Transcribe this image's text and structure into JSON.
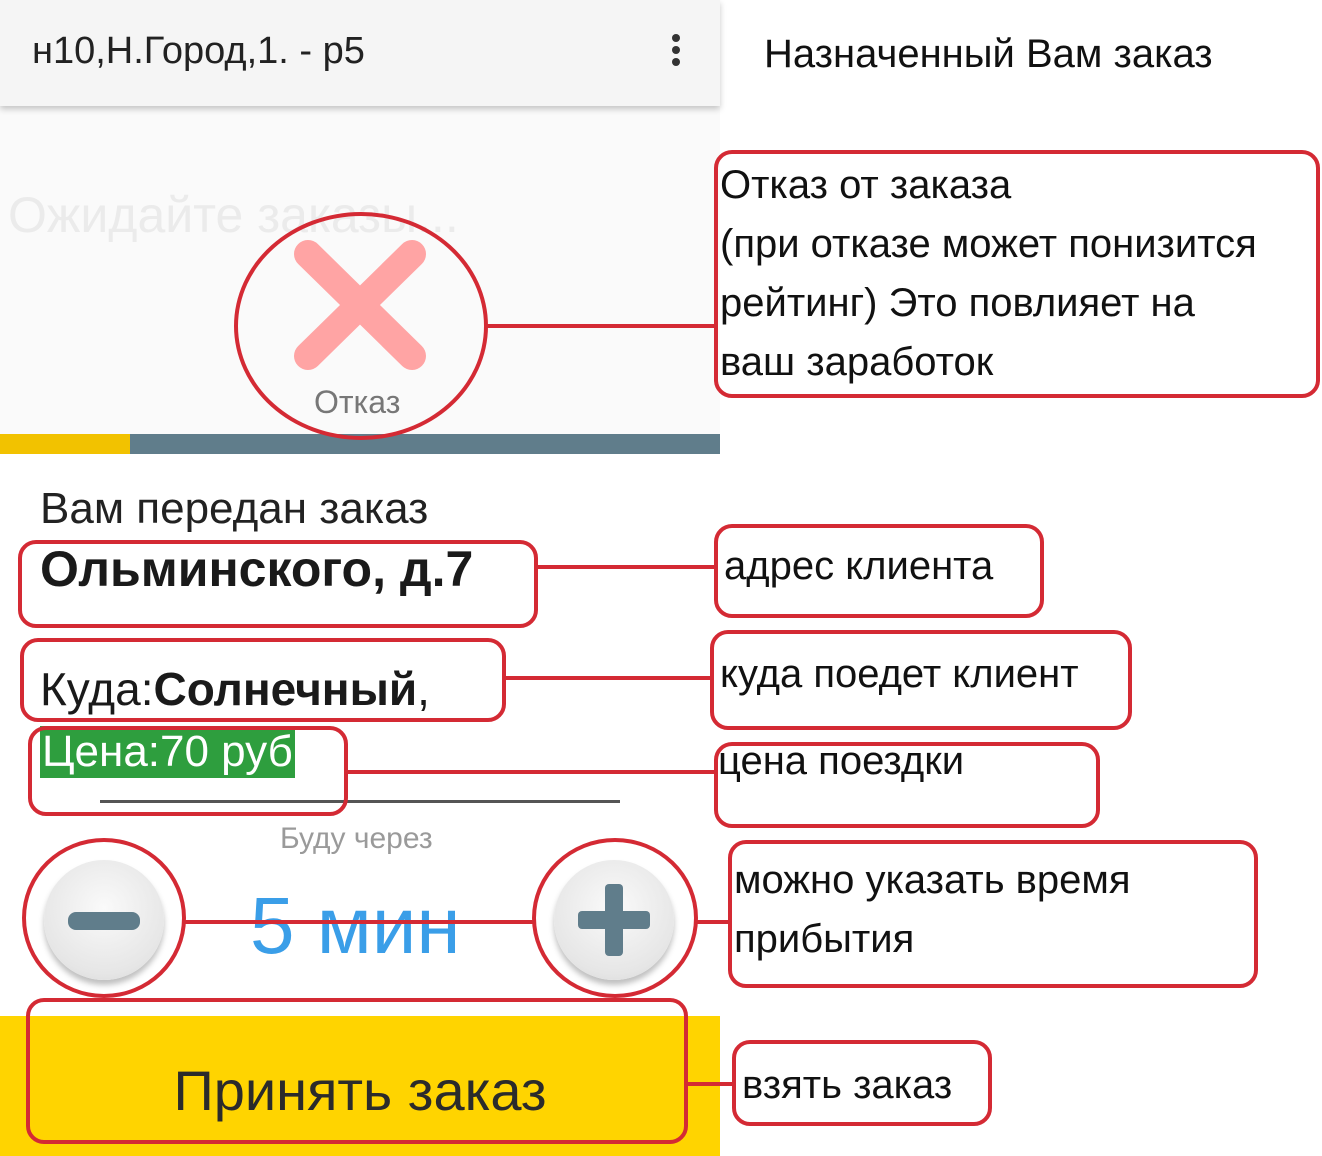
{
  "appbar": {
    "title": "н10,Н.Город,1. - р5",
    "menu_icon": "more-vert-icon"
  },
  "waiting": {
    "text": "Ожидайте заказы..."
  },
  "reject": {
    "icon": "close-icon",
    "label": "Отказ"
  },
  "progress": {
    "fraction": 0.18,
    "fill_color": "#f2c200",
    "track_color": "#607d8b"
  },
  "order": {
    "heading": "Вам передан заказ",
    "pickup_address": "Ольминского, д.7",
    "destination_label": "Куда:",
    "destination_value": "Солнечный",
    "destination_suffix": ",",
    "price": "Цена:70 руб"
  },
  "eta": {
    "caption": "Буду через",
    "value": "5 мин",
    "minus_icon": "minus-icon",
    "plus_icon": "plus-icon"
  },
  "accept": {
    "label": "Принять заказ"
  },
  "annotations": {
    "title": "Назначенный Вам заказ",
    "reject_note": [
      "Отказ от заказа",
      "(при отказе может понизится",
      "рейтинг) Это повлияет на",
      "ваш заработок"
    ],
    "address_note": "адрес клиента",
    "destination_note": "куда поедет клиент",
    "price_note": "цена поездки",
    "eta_note": [
      "можно указать время",
      "прибытия"
    ],
    "accept_note": "взять заказ",
    "highlight_color": "#d42a34"
  }
}
